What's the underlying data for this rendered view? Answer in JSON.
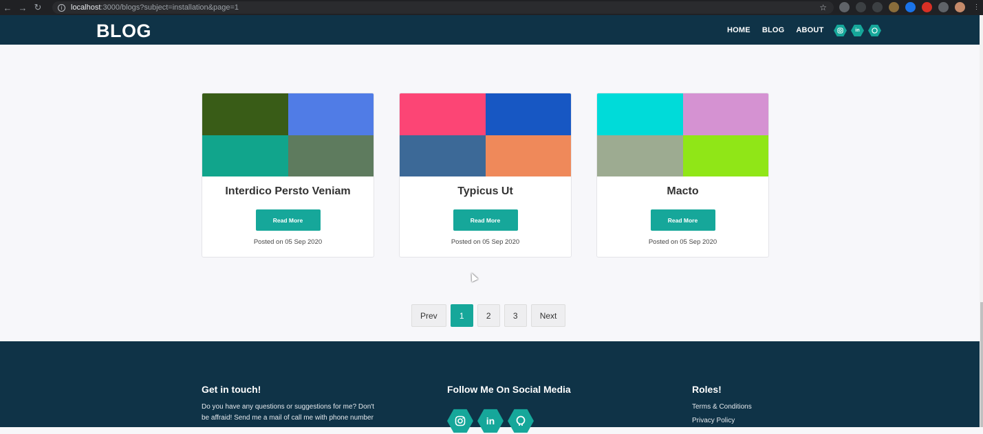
{
  "browser": {
    "url_host": "localhost",
    "url_rest": ":3000/blogs?subject=installation&page=1"
  },
  "header": {
    "logo": "BLOG",
    "nav": [
      "HOME",
      "BLOG",
      "ABOUT"
    ],
    "social_icons": [
      "instagram-icon",
      "linkedin-icon",
      "github-icon"
    ]
  },
  "cards": [
    {
      "title": "Interdico Persto Veniam",
      "button": "Read More",
      "posted": "Posted on 05 Sep 2020",
      "colors": [
        "#395c17",
        "#507ce6",
        "#11a58c",
        "#5e7b5e"
      ]
    },
    {
      "title": "Typicus Ut",
      "button": "Read More",
      "posted": "Posted on 05 Sep 2020",
      "colors": [
        "#fc4575",
        "#1757c3",
        "#3c6997",
        "#ef895a"
      ]
    },
    {
      "title": "Macto",
      "button": "Read More",
      "posted": "Posted on 05 Sep 2020",
      "colors": [
        "#00dbd9",
        "#d592d2",
        "#9dab91",
        "#90e617"
      ]
    }
  ],
  "pagination": {
    "prev": "Prev",
    "pages": [
      "1",
      "2",
      "3"
    ],
    "next": "Next",
    "active": "1"
  },
  "footer": {
    "contact": {
      "title": "Get in touch!",
      "text_line1": "Do you have any questions or suggestions for me? Don't",
      "text_line2": "be affraid! Send me a mail of call me with phone number"
    },
    "social": {
      "title": "Follow Me On Social Media",
      "icons": [
        "instagram-icon",
        "linkedin-icon",
        "github-icon"
      ]
    },
    "roles": {
      "title": "Roles!",
      "links": [
        "Terms & Conditions",
        "Privacy Policy"
      ]
    }
  },
  "colors": {
    "navy": "#0f3347",
    "accent": "#16a79a"
  }
}
